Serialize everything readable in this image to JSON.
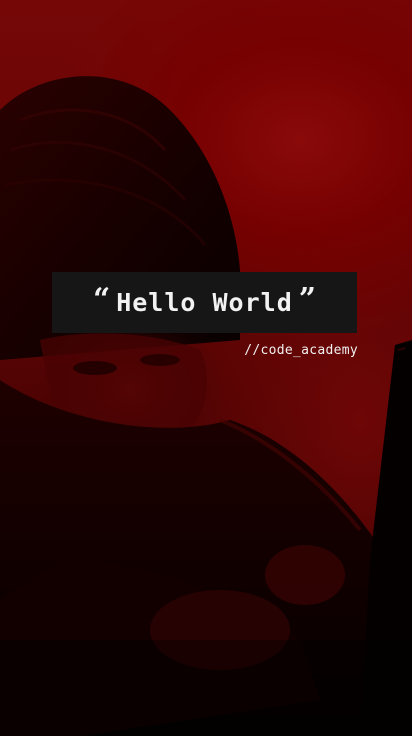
{
  "poster": {
    "headline": "Hello World",
    "quote_open": "“",
    "quote_close": "”",
    "tagline": "//code_academy"
  },
  "colors": {
    "background_tint": "#7a0606",
    "shadow": "#0a0000",
    "title_box": "#161616",
    "text": "#f2f2f2"
  }
}
